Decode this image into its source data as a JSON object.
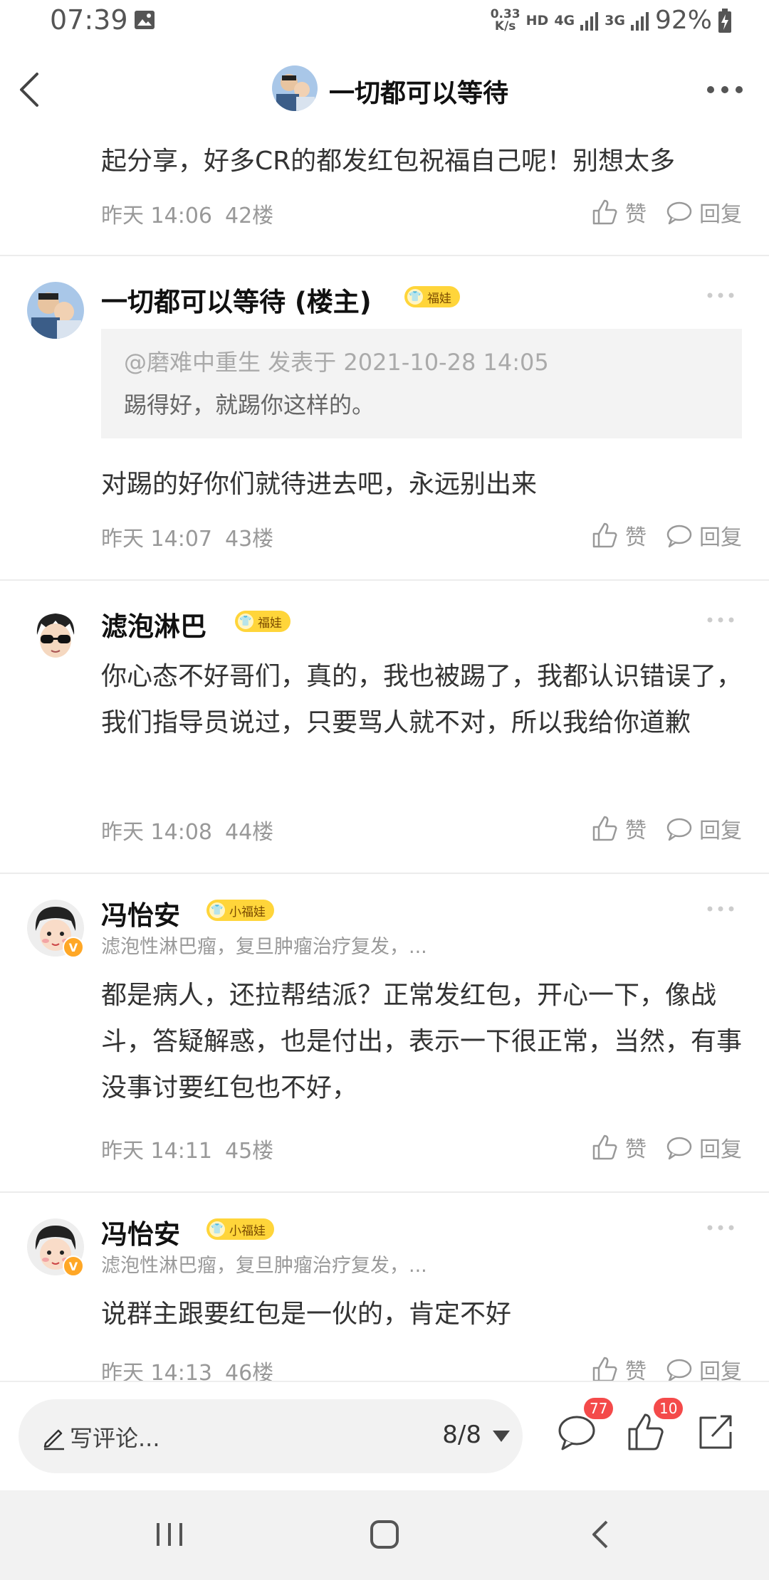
{
  "status_bar": {
    "time": "07:39",
    "net_speed_value": "0.33",
    "net_speed_unit": "K/s",
    "hd": "HD",
    "net_4g": "4G",
    "net_3g": "3G",
    "battery": "92%"
  },
  "header": {
    "title": "一切都可以等待"
  },
  "first_post_tail": {
    "text": "起分享，好多CR的都发红包祝福自己呢！别想太多",
    "time": "昨天 14:06",
    "floor": "42楼",
    "like_label": "赞",
    "reply_label": "回复"
  },
  "posts": [
    {
      "username": "一切都可以等待 (楼主)",
      "badge": "福娃",
      "quote_meta": "@磨难中重生 发表于 2021-10-28 14:05",
      "quote_text": "踢得好，就踢你这样的。",
      "text": "对踢的好你们就待进去吧，永远别出来",
      "time": "昨天 14:07",
      "floor": "43楼",
      "like_label": "赞",
      "reply_label": "回复"
    },
    {
      "username": "滤泡淋巴",
      "badge": "福娃",
      "text": "你心态不好哥们，真的，我也被踢了，我都认识错误了，我们指导员说过，只要骂人就不对，所以我给你道歉",
      "time": "昨天 14:08",
      "floor": "44楼",
      "like_label": "赞",
      "reply_label": "回复"
    },
    {
      "username": "冯怡安",
      "badge": "小福娃",
      "subline": "滤泡性淋巴瘤，复旦肿瘤治疗复发，...",
      "text": "都是病人，还拉帮结派？正常发红包，开心一下，像战斗，答疑解惑，也是付出，表示一下很正常，当然，有事没事讨要红包也不好，",
      "time": "昨天 14:11",
      "floor": "45楼",
      "like_label": "赞",
      "reply_label": "回复"
    },
    {
      "username": "冯怡安",
      "badge": "小福娃",
      "subline": "滤泡性淋巴瘤，复旦肿瘤治疗复发，...",
      "text": "说群主跟要红包是一伙的，肯定不好",
      "time": "昨天 14:13",
      "floor": "46楼",
      "like_label": "赞",
      "reply_label": "回复"
    }
  ],
  "bottom_bar": {
    "comment_placeholder": "写评论...",
    "page_indicator": "8/8",
    "comment_count": "77",
    "like_count": "10"
  },
  "colors": {
    "badge_yellow": "#ffd53a",
    "red_badge": "#f44a4a",
    "meta_gray": "#999999"
  }
}
